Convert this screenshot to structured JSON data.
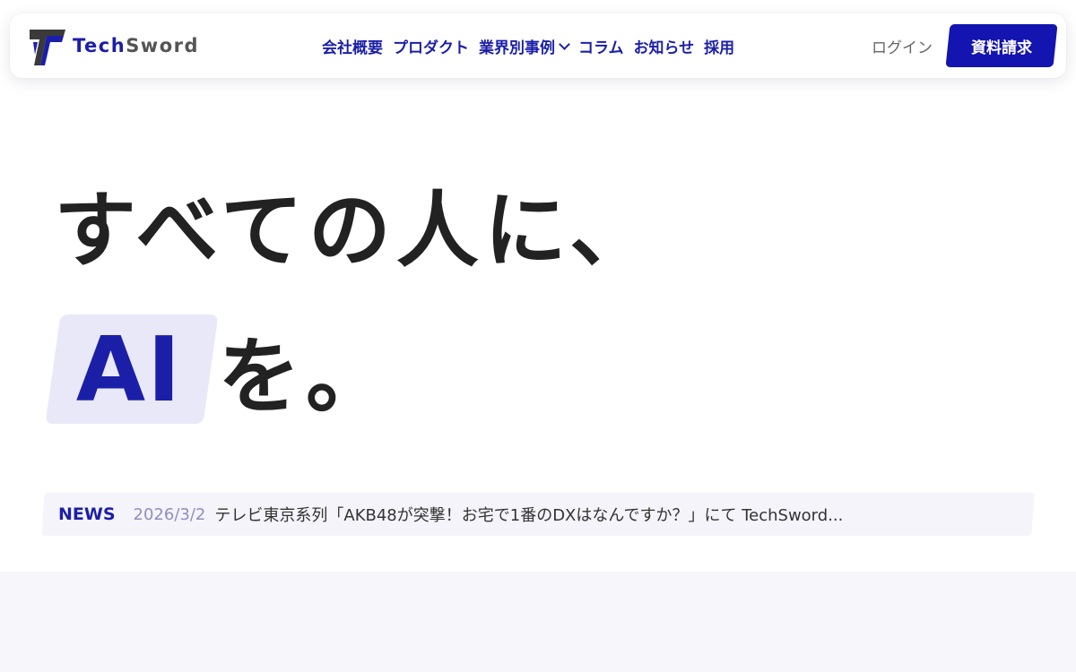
{
  "brand": {
    "name_part1": "Tech",
    "name_part2": "Sword",
    "accent_color": "#1b1fa8",
    "cta_color": "#1414b0",
    "logo_icon": "techsword-logo-mark"
  },
  "nav": {
    "items": [
      {
        "label": "会社概要"
      },
      {
        "label": "プロダクト"
      },
      {
        "label": "業界別事例",
        "has_dropdown": true,
        "icon": "chevron-down-icon"
      },
      {
        "label": "コラム"
      },
      {
        "label": "お知らせ"
      },
      {
        "label": "採用"
      }
    ],
    "login_label": "ログイン",
    "cta_label": "資料請求"
  },
  "hero": {
    "line1": "すべての人に、",
    "highlight": "AI",
    "line2_suffix": "を。"
  },
  "news": {
    "label": "NEWS",
    "date": "2026/3/2",
    "title": "テレビ東京系列「AKB48が突撃！お宅で1番のDXはなんですか？」にて TechSword..."
  }
}
